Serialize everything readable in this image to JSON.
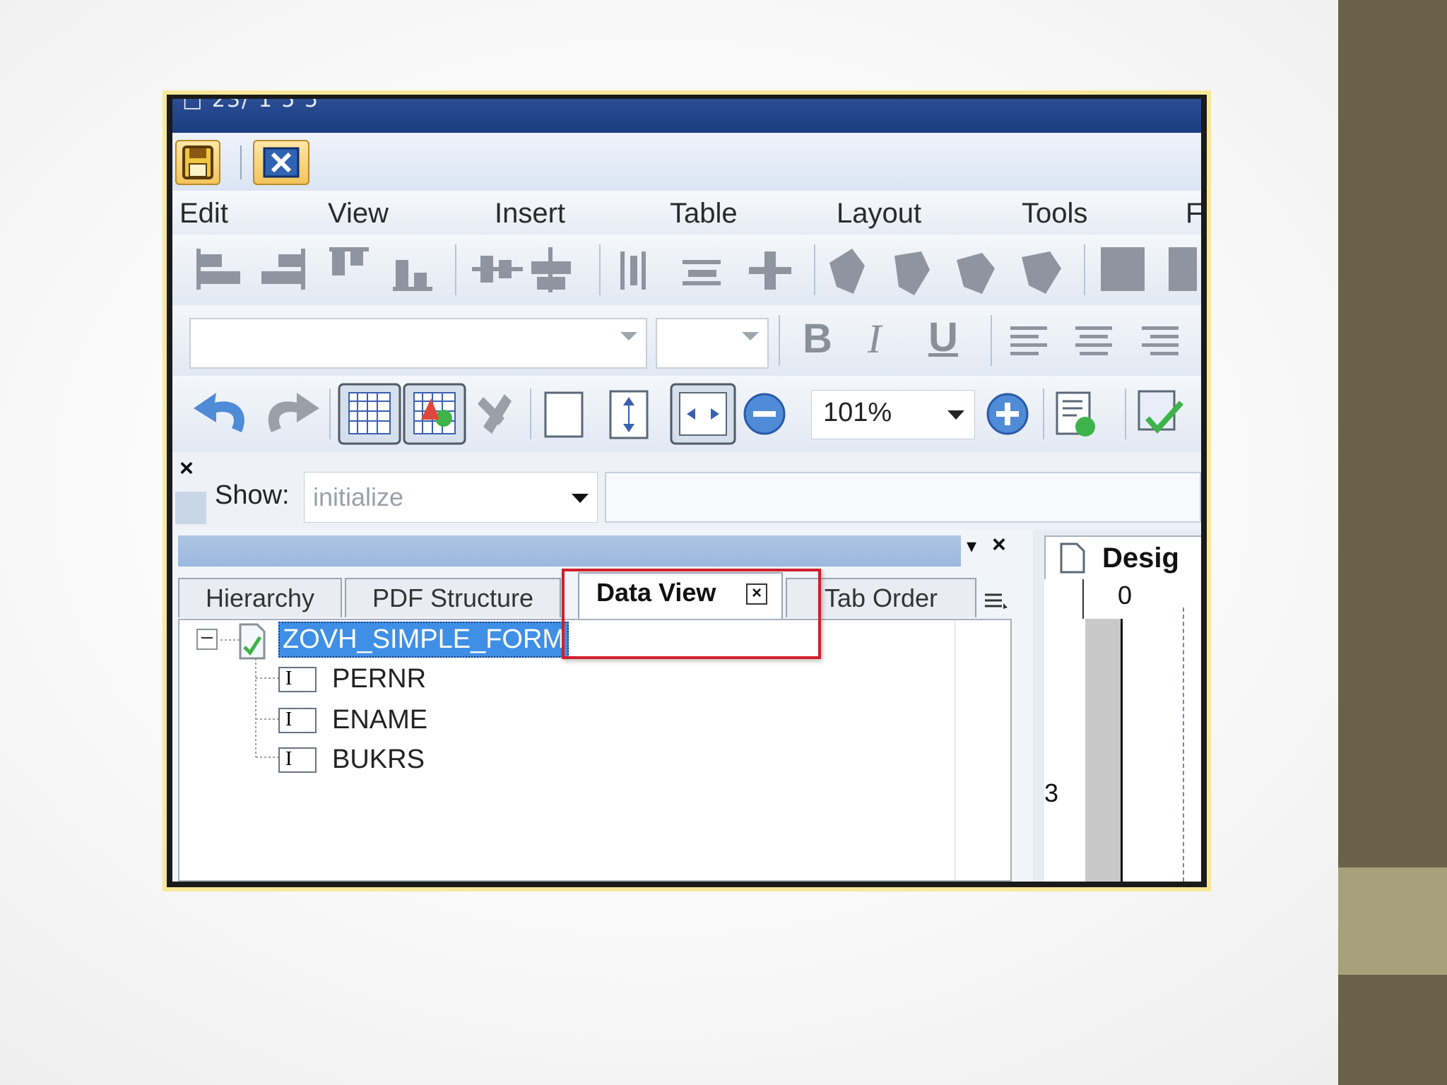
{
  "window": {
    "title": "□ 23/ 1 5 5"
  },
  "quick_toolbar": {
    "save": "save-icon",
    "close": "close-icon"
  },
  "menu": {
    "items": [
      "Edit",
      "View",
      "Insert",
      "Table",
      "Layout",
      "Tools",
      "F"
    ]
  },
  "formatting": {
    "font_name_value": "",
    "font_size_value": "",
    "bold_label": "B",
    "italic_label": "I",
    "underline_label": "U"
  },
  "zoom": {
    "value": "101%"
  },
  "show_bar": {
    "close_label": "×",
    "show_label": "Show:",
    "event_value": "initialize"
  },
  "panel": {
    "tabs": [
      "Hierarchy",
      "PDF Structure",
      "Data View",
      "Tab Order"
    ],
    "active_tab": "Data View",
    "tab_close_label": "×",
    "header_menu_label": "▾",
    "header_close_label": "×"
  },
  "tree": {
    "expand_label": "−",
    "root": "ZOVH_SIMPLE_FORM",
    "children": [
      "PERNR",
      "ENAME",
      "BUKRS"
    ]
  },
  "design": {
    "tab_label": "Desig",
    "ruler_top_label": "0",
    "ruler_left_label": "3"
  },
  "colors": {
    "titlebar": "#1c3d80",
    "highlight": "#d21f2a",
    "selection": "#3f8fe6",
    "side_dark": "#6b614a",
    "side_light": "#a8a07a"
  }
}
